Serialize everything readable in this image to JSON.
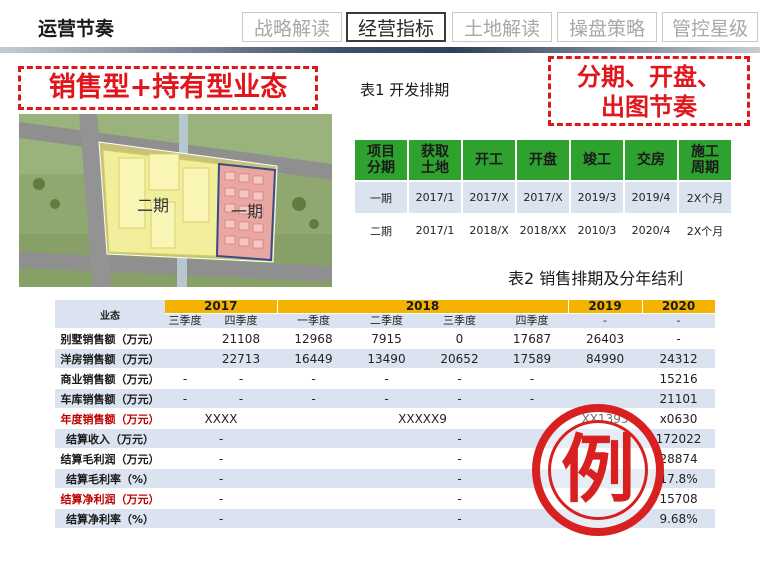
{
  "header": {
    "title": "运营节奏",
    "tabs": [
      {
        "label": "战略解读",
        "active": false
      },
      {
        "label": "经营指标",
        "active": true
      },
      {
        "label": "土地解读",
        "active": false
      },
      {
        "label": "操盘策略",
        "active": false
      },
      {
        "label": "管控星级",
        "active": false
      }
    ]
  },
  "callouts": {
    "left": "销售型+持有型业态",
    "right_line1": "分期、开盘、",
    "right_line2": "出图节奏"
  },
  "site_plan": {
    "phase2_label": "二期",
    "phase1_label": "一期"
  },
  "table1": {
    "caption": "表1 开发排期",
    "headers": [
      [
        "项目",
        "分期"
      ],
      [
        "获取",
        "土地"
      ],
      [
        "开工"
      ],
      [
        "开盘"
      ],
      [
        "竣工"
      ],
      [
        "交房"
      ],
      [
        "施工",
        "周期"
      ]
    ],
    "rows": [
      [
        "一期",
        "2017/1",
        "2017/X",
        "2017/X",
        "2019/3",
        "2019/4",
        "2X个月"
      ],
      [
        "二期",
        "2017/1",
        "2018/X",
        "2018/XX",
        "2010/3",
        "2020/4",
        "2X个月"
      ]
    ]
  },
  "table2": {
    "caption": "表2 销售排期及分年结利",
    "corner_label": "业态",
    "years": [
      "2017",
      "2018",
      "2019",
      "2020"
    ],
    "quarters": [
      "三季度",
      "四季度",
      "一季度",
      "二季度",
      "三季度",
      "四季度",
      "-",
      "-"
    ],
    "rows": [
      {
        "label": "别墅销售额（万元）",
        "cells": [
          "",
          "21108",
          "12968",
          "7915",
          "0",
          "17687",
          "26403",
          "-"
        ]
      },
      {
        "label": "洋房销售额（万元）",
        "cells": [
          "",
          "22713",
          "16449",
          "13490",
          "20652",
          "17589",
          "84990",
          "24312"
        ]
      },
      {
        "label": "商业销售额（万元）",
        "cells": [
          "-",
          "-",
          "-",
          "-",
          "-",
          "-",
          "",
          "15216"
        ]
      },
      {
        "label": "车库销售额（万元）",
        "cells": [
          "-",
          "-",
          "-",
          "-",
          "-",
          "-",
          "",
          "21101"
        ]
      }
    ],
    "annual_sales": {
      "label": "年度销售额（万元）",
      "y2017": "XXXX",
      "y2018": "XXXXX9",
      "y2019": "XX1393",
      "y2020": "x0630"
    },
    "settle_rows": [
      {
        "label": "结算收入（万元）",
        "y2017": "-",
        "y2018": "-",
        "y2020": "172022",
        "red": false
      },
      {
        "label": "结算毛利润（万元）",
        "y2017": "-",
        "y2018": "-",
        "y2020": "28874",
        "red": false
      },
      {
        "label": "结算毛利率（%）",
        "y2017": "-",
        "y2018": "-",
        "y2020": "17.8%",
        "red": false
      },
      {
        "label": "结算净利润（万元）",
        "y2017": "-",
        "y2018": "-",
        "y2020": "15708",
        "red": true
      },
      {
        "label": "结算净利率（%）",
        "y2017": "-",
        "y2018": "-",
        "y2020": "9.68%",
        "red": false
      }
    ]
  },
  "stamp": {
    "text": "例"
  },
  "colors": {
    "table1_header": "#2fa12f",
    "table2_year_header": "#f3b300",
    "row_tint": "#dbe3f0",
    "callout_red": "#e0161c"
  }
}
